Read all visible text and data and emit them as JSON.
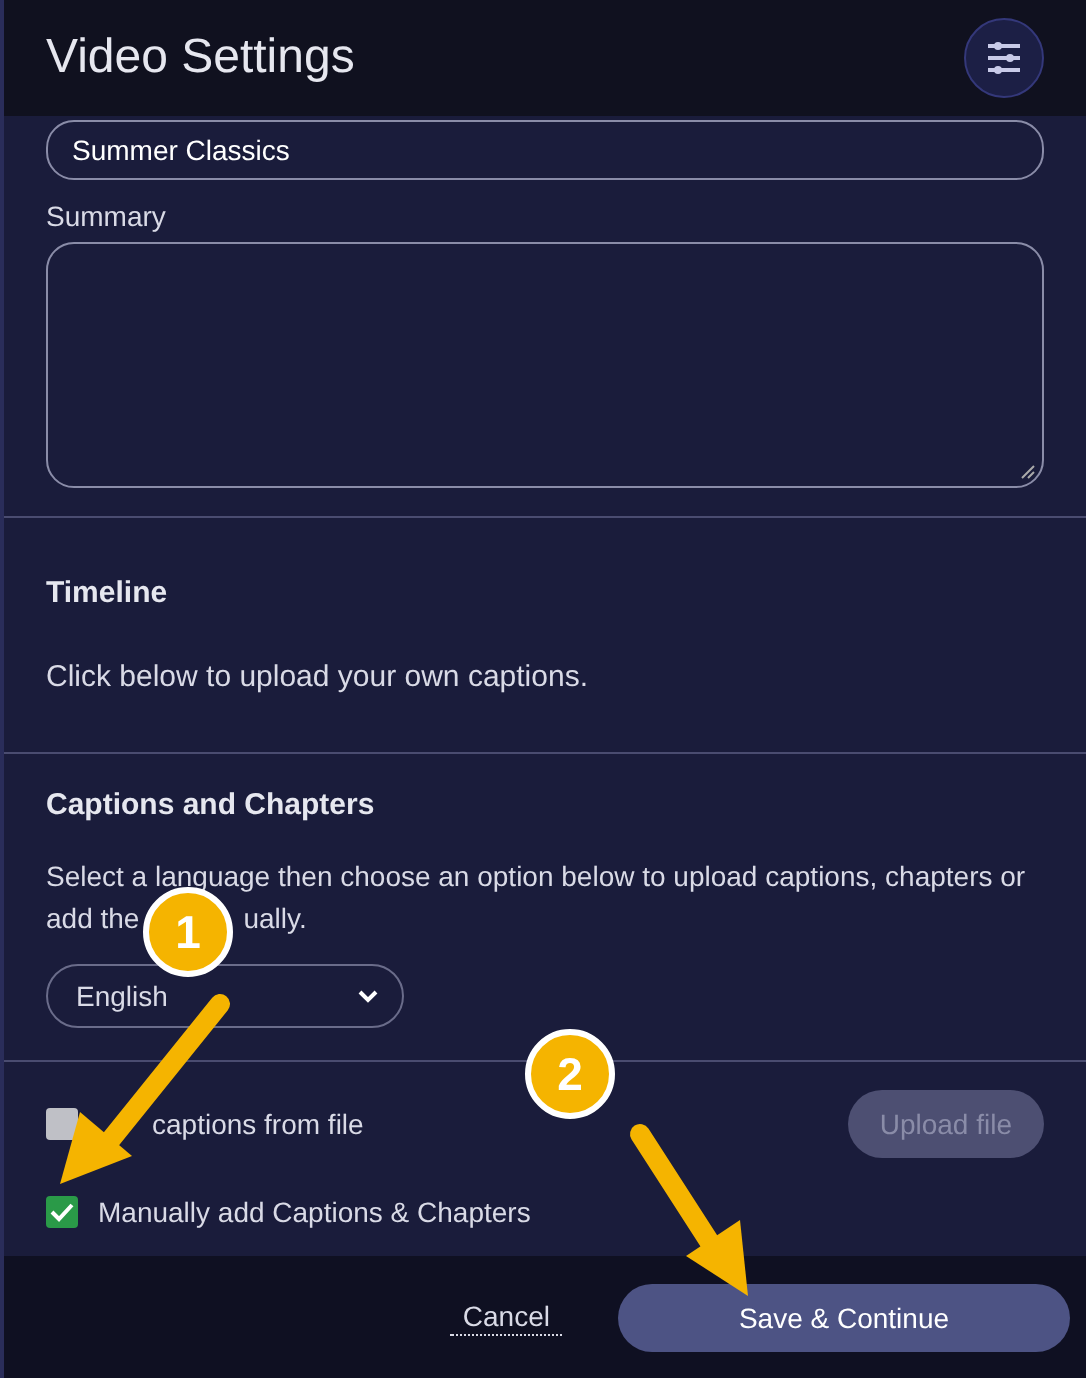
{
  "window": {
    "title": "Video Settings"
  },
  "title_field": {
    "value": "Summer Classics"
  },
  "summary": {
    "label": "Summary"
  },
  "timeline": {
    "heading": "Timeline",
    "text": "Click below to upload your own captions."
  },
  "captions": {
    "heading": "Captions and Chapters",
    "description": [
      "Select a language then choose an option below to upload captions, chapters or",
      "add the",
      "ually."
    ],
    "language": "English",
    "options": [
      {
        "kind": "upload",
        "label": "captions from file",
        "checked": false
      },
      {
        "kind": "plain",
        "label": "Manually add Captions & Chapters",
        "checked": true
      }
    ],
    "upload_button": {
      "label": "Upload file",
      "disabled": true
    }
  },
  "footer": {
    "cancel": "Cancel",
    "save": "Save & Continue"
  },
  "annotations": [
    {
      "label": "1"
    },
    {
      "label": "2"
    }
  ]
}
